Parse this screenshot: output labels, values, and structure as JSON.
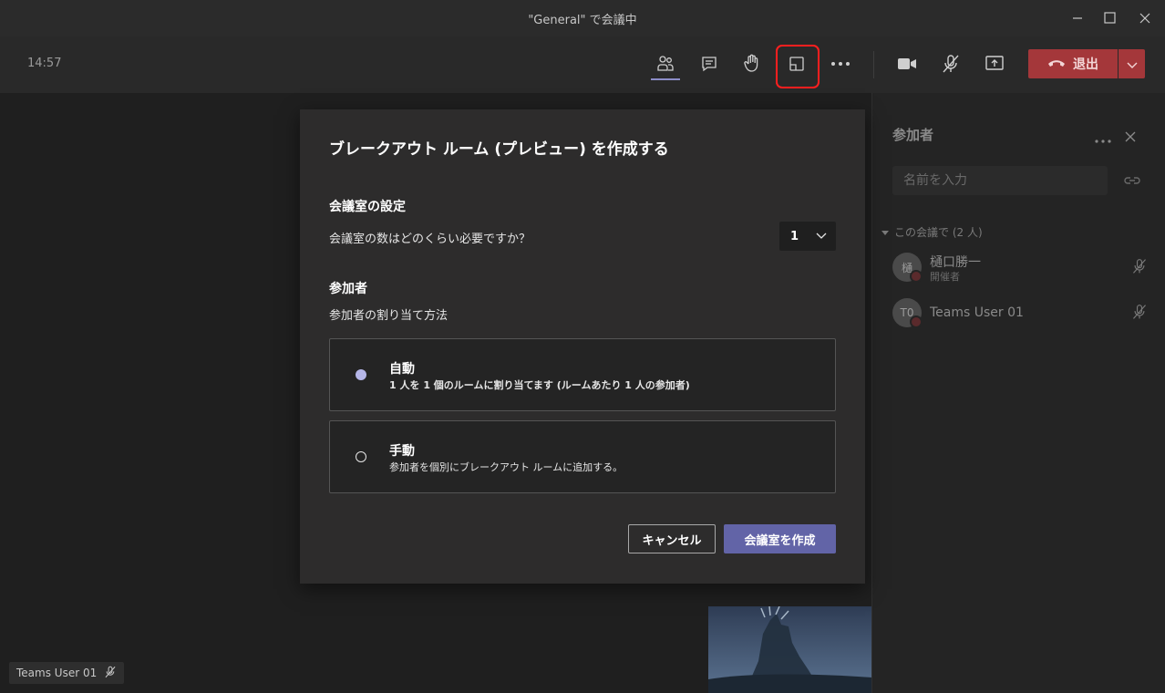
{
  "window": {
    "title": "\"General\" で会議中"
  },
  "toolbar": {
    "clock": "14:57",
    "leave_label": "退出",
    "icons": [
      "participants-icon",
      "chat-icon",
      "raise-hand-icon",
      "breakout-rooms-icon",
      "more-icon",
      "camera-icon",
      "mic-off-icon",
      "share-icon"
    ]
  },
  "dialog": {
    "title": "ブレークアウト ルーム (プレビュー) を作成する",
    "room_settings_heading": "会議室の設定",
    "room_count_question": "会議室の数はどのくらい必要ですか？",
    "room_count_value": "1",
    "participants_heading": "参加者",
    "assign_method_label": "参加者の割り当て方法",
    "options": [
      {
        "title": "自動",
        "description": "1 人を 1 個のルームに割り当てます (ルームあたり 1 人の参加者)",
        "selected": true
      },
      {
        "title": "手動",
        "description": "参加者を個別にブレークアウト ルームに追加する。",
        "selected": false
      }
    ],
    "cancel_label": "キャンセル",
    "create_label": "会議室を作成"
  },
  "panel": {
    "title": "参加者",
    "search_placeholder": "名前を入力",
    "section_label": "この会議で (2 人)",
    "people": [
      {
        "initials": "樋",
        "name": "樋口勝一",
        "role": "開催者"
      },
      {
        "initials": "T0",
        "name": "Teams User 01",
        "role": ""
      }
    ]
  },
  "stage": {
    "self_label": "Teams User 01"
  },
  "colors": {
    "accent": "#6264a7",
    "leave": "#a4373a",
    "highlight": "#ff1f1f"
  }
}
